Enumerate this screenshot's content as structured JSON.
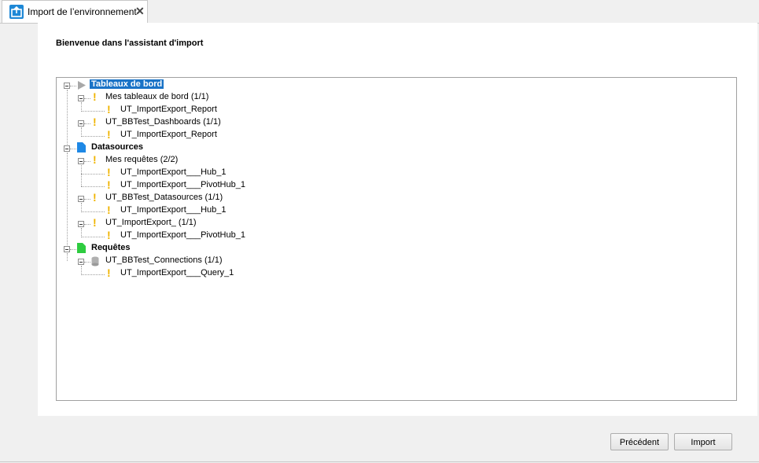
{
  "tab": {
    "title": "Import de l’environnement",
    "close_glyph": "✕",
    "icon": "import-icon"
  },
  "main": {
    "heading": "Bienvenue dans l'assistant d'import"
  },
  "tree": {
    "nodes": [
      {
        "label": "Tableaux de bord",
        "level": 0,
        "icon": "triangle-icon",
        "selected": true
      },
      {
        "label": "Mes tableaux de bord   (1/1)",
        "level": 1,
        "icon": "warning-icon"
      },
      {
        "label": "UT_ImportExport_Report",
        "level": 2,
        "icon": "warning-icon"
      },
      {
        "label": "UT_BBTest_Dashboards   (1/1)",
        "level": 1,
        "icon": "warning-icon"
      },
      {
        "label": "UT_ImportExport_Report",
        "level": 2,
        "icon": "warning-icon"
      },
      {
        "label": "Datasources",
        "level": 0,
        "icon": "document-blue-icon"
      },
      {
        "label": "Mes requêtes   (2/2)",
        "level": 1,
        "icon": "warning-icon"
      },
      {
        "label": "UT_ImportExport___Hub_1",
        "level": 2,
        "icon": "warning-icon"
      },
      {
        "label": "UT_ImportExport___PivotHub_1",
        "level": 2,
        "icon": "warning-icon"
      },
      {
        "label": "UT_BBTest_Datasources   (1/1)",
        "level": 1,
        "icon": "warning-icon"
      },
      {
        "label": "UT_ImportExport___Hub_1",
        "level": 2,
        "icon": "warning-icon"
      },
      {
        "label": "UT_ImportExport_   (1/1)",
        "level": 1,
        "icon": "warning-icon"
      },
      {
        "label": "UT_ImportExport___PivotHub_1",
        "level": 2,
        "icon": "warning-icon"
      },
      {
        "label": "Requêtes",
        "level": 0,
        "icon": "document-green-icon"
      },
      {
        "label": "UT_BBTest_Connections   (1/1)",
        "level": 1,
        "icon": "database-icon"
      },
      {
        "label": "UT_ImportExport___Query_1",
        "level": 2,
        "icon": "warning-icon"
      }
    ]
  },
  "footer": {
    "previous_label": "Précédent",
    "import_label": "Import"
  },
  "colors": {
    "selection": "#1a73c7",
    "warning": "#f0b400",
    "doc_blue": "#1e88e5",
    "doc_green": "#2ecc40"
  }
}
